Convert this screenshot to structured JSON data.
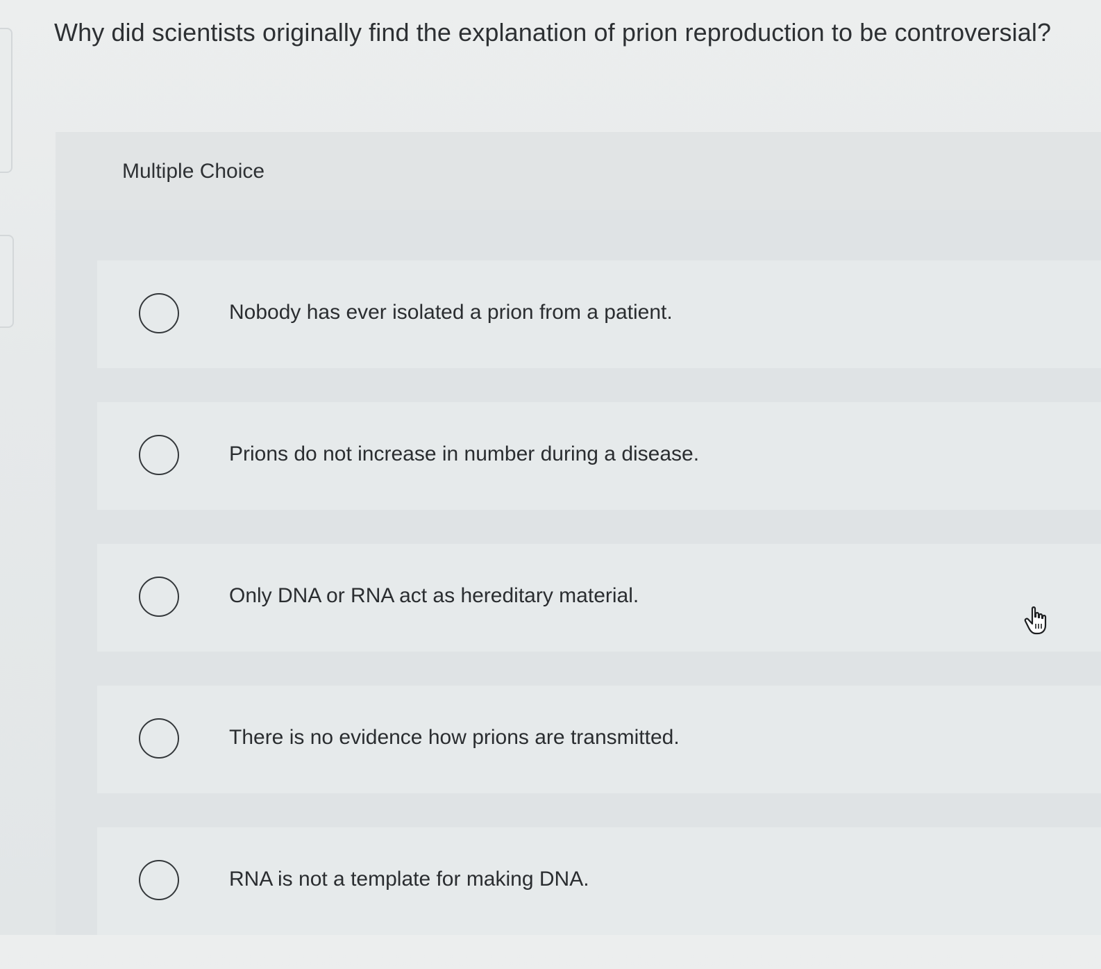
{
  "question": {
    "text": "Why did scientists originally find the explanation of prion reproduction to be controversial?"
  },
  "section": {
    "label": "Multiple Choice"
  },
  "options": [
    {
      "text": "Nobody has ever isolated a prion from a patient."
    },
    {
      "text": "Prions do not increase in number during a disease."
    },
    {
      "text": "Only DNA or RNA act as hereditary material."
    },
    {
      "text": "There is no evidence how prions are transmitted."
    },
    {
      "text": "RNA is not a template for making DNA."
    }
  ],
  "icons": {
    "radio": "radio-unchecked-icon",
    "cursor": "hand-pointer-icon"
  }
}
